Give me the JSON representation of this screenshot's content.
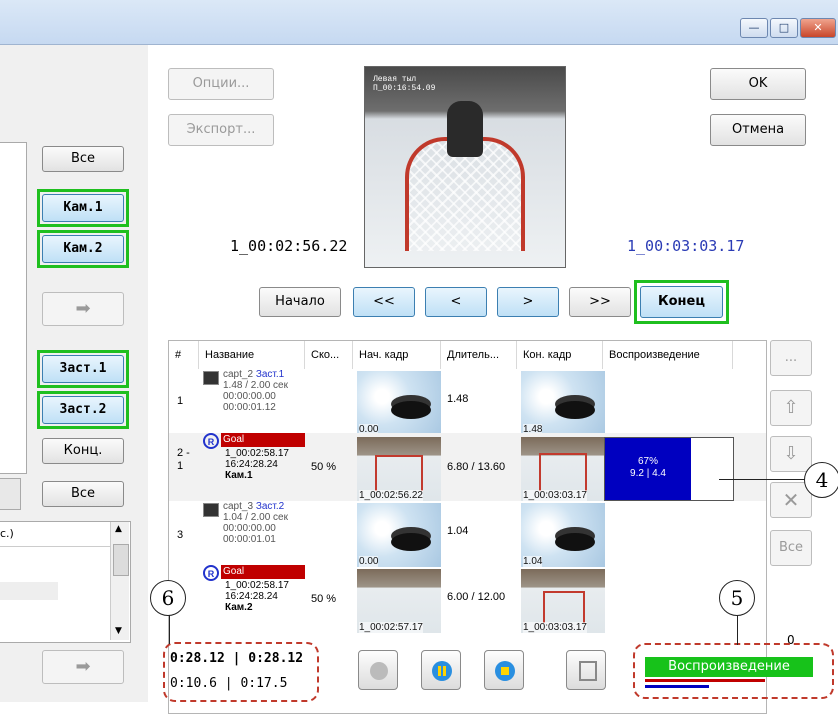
{
  "window": {
    "min": "—",
    "max": "□",
    "close": "✕"
  },
  "left_panel": {
    "all_top": "Все",
    "cam1": "Кам.1",
    "cam2": "Кам.2",
    "screen1": "Заст.1",
    "screen2": "Заст.2",
    "end": "Конц.",
    "all_bottom": "Все",
    "list_header": "с.)"
  },
  "top": {
    "options": "Опции...",
    "export": "Экспорт...",
    "ok": "OK",
    "cancel": "Отмена",
    "tc_left": "1_00:02:56.22",
    "tc_right": "1_00:03:03.17",
    "video_overlay_1": "Левая тыл",
    "video_overlay_2": "П_00:16:54.09"
  },
  "nav": {
    "start": "Начало",
    "rew_fast": "<<",
    "rew": "<",
    "fwd": ">",
    "fwd_fast": ">>",
    "end": "Конец"
  },
  "table": {
    "headers": [
      "#",
      "Название",
      "Ско...",
      "Нач. кадр",
      "Длитель...",
      "Кон. кадр",
      "Воспроизведение"
    ],
    "rows": [
      {
        "num": "1",
        "title": "capt_2",
        "tag": "Заст.1",
        "l2": "1.48 / 2.00 сек",
        "l3": "00:00:00.00",
        "l4": "00:00:01.12",
        "speed": "",
        "start_cap": "0.00",
        "duration": "1.48",
        "end_cap": "1.48",
        "progress": ""
      },
      {
        "num": "2 - 1",
        "title": "Goal",
        "l2": "1_00:02:58.17",
        "l3": "16:24:28.24",
        "l4": "Кам.1",
        "speed": "50 %",
        "start_cap": "1_00:02:56.22",
        "duration": "6.80 / 13.60",
        "end_cap": "1_00:03:03.17",
        "progress_pct": "67%",
        "progress_sub": "9.2 | 4.4",
        "progress_fraction": 0.67
      },
      {
        "num": "3",
        "title": "capt_3",
        "tag": "Заст.2",
        "l2": "1.04 / 2.00 сек",
        "l3": "00:00:00.00",
        "l4": "00:00:01.01",
        "speed": "",
        "start_cap": "0.00",
        "duration": "1.04",
        "end_cap": "1.04"
      },
      {
        "num": "",
        "title": "Goal",
        "l2": "1_00:02:58.17",
        "l3": "16:24:28.24",
        "l4": "Кам.2",
        "speed": "50 %",
        "start_cap": "1_00:02:57.17",
        "duration": "6.00 / 12.00",
        "end_cap": "1_00:03:03.17"
      }
    ]
  },
  "right_col": {
    "more": "...",
    "all": "Все",
    "count": "0"
  },
  "bottom": {
    "time1": "0:28.12 | 0:28.12",
    "time2": "0:10.6 | 0:17.5",
    "status": "Воспроизведение"
  },
  "callouts": {
    "c4": "4",
    "c5": "5",
    "c6": "6"
  },
  "colors": {
    "highlight": "#1fbf1f",
    "goal_red": "#c00000",
    "progress_blue": "#0000c0",
    "status_green": "#17c21a",
    "callout_red": "#c0392b"
  }
}
